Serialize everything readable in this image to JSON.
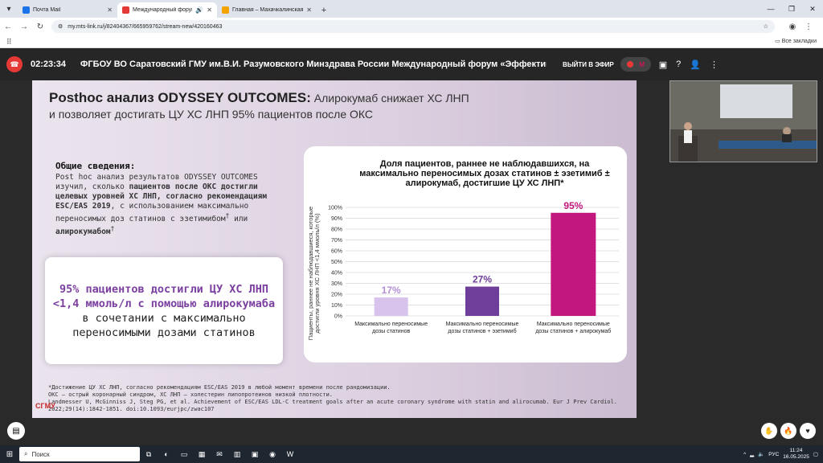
{
  "browser": {
    "tabs": [
      {
        "title": "Почта Mail",
        "active": false
      },
      {
        "title": "Международный форум «",
        "active": true
      },
      {
        "title": "Главная – Махачкалинская к...",
        "active": false
      }
    ],
    "url": "my.mts-link.ru/j/82404367/665959762/stream-new/420160463",
    "bookmarks_label": "Все закладки"
  },
  "stream": {
    "time": "02:23:34",
    "title": "ФГБОУ ВО Саратовский ГМУ им.В.И. Разумовского Минздрава России   Международный форум «Эффективные терапевтические страт",
    "exit_label": "ВЫЙТИ В ЭФИР",
    "rec_label": "M"
  },
  "slide": {
    "title_bold": "Posthoc анализ ODYSSEY OUTCOMES:",
    "title_rest": " Алирокумаб снижает ХС ЛНП",
    "title_line2": "и позволяет достигать ЦУ ХС ЛНП 95% пациентов после ОКС",
    "gen_heading": "Общие сведения:",
    "gen_p1": "Post hoc анализ результатов ODYSSEY OUTCOMES изучил, сколько ",
    "gen_b1": "пациентов после ОКС достигли целевых уровней ХС ЛНП, согласно рекомендациям ESC/EAS 2019",
    "gen_p2": ", с использованием максимально переносимых доз статинов с эзетимибом",
    "gen_sup1": "†",
    "gen_p3": " или ",
    "gen_b2": "алирокумабом",
    "gen_sup2": "†",
    "callout_p": "95% пациентов достигли ЦУ ХС ЛНП <1,4 ммоль/л с помощью алирокумаба",
    "callout_rest": " в сочетании с максимально переносимыми дозами статинов",
    "footnote1": "*Достижение ЦУ ХС ЛНП, согласно рекомендациям ESC/EAS 2019 в любой момент времени после рандомизации.",
    "footnote2": "ОКС – острый коронарный синдром, ХС ЛНП – холестерин липопротеинов низкой плотности.",
    "footnote3": "Landmesser U, McGinniss J, Steg PG, et al. Achievement of ESC/EAS LDL-C treatment goals after an acute coronary syndrome with statin and alirocumab. Eur J Prev Cardiol. 2022;29(14):1842-1851. doi:10.1093/eurjpc/zwac107",
    "logo": "СГМУ"
  },
  "chart_data": {
    "type": "bar",
    "title": "Доля пациентов, раннее не наблюдавшихся, на максимально переносимых дозах статинов ± эзетимиб ± алирокумаб, достигшие ЦУ ХС ЛНП*",
    "ylabel": "Пациенты, раннее не наблюдавшиеся, которые достигли уровня ХС ЛНП <1,4 ммоль/л (%)",
    "categories": [
      "Максимально переносимые дозы статинов",
      "Максимально переносимые дозы статинов + эзетимиб",
      "Максимально переносимые дозы статинов + алирокумаб"
    ],
    "values": [
      17,
      27,
      95
    ],
    "value_labels": [
      "17%",
      "27%",
      "95%"
    ],
    "colors": [
      "#d8c3ec",
      "#6f3d9a",
      "#c2177d"
    ],
    "yticks": [
      "0%",
      "10%",
      "20%",
      "30%",
      "40%",
      "50%",
      "60%",
      "70%",
      "80%",
      "90%",
      "100%"
    ],
    "ylim": [
      0,
      100
    ],
    "grid": true
  },
  "taskbar": {
    "search_placeholder": "Поиск",
    "lang": "РУС",
    "time": "11:24",
    "date": "16.05.2025"
  }
}
